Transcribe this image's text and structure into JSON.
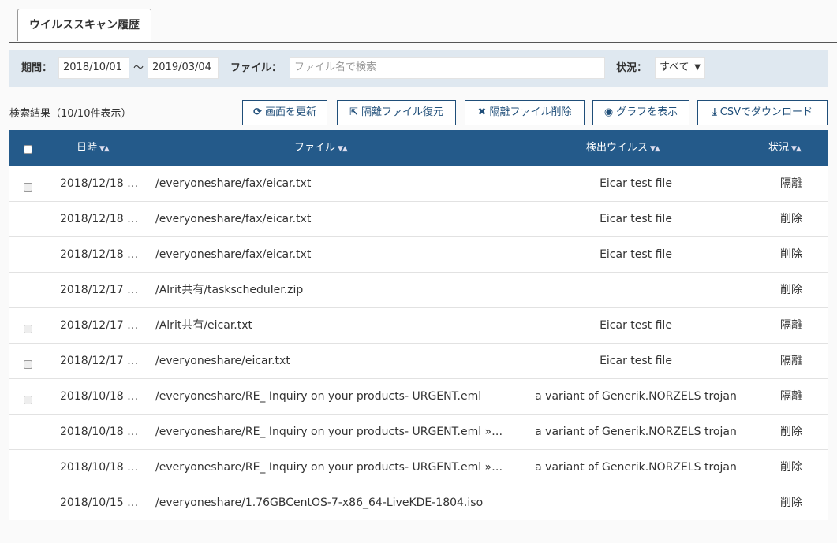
{
  "tab": {
    "label": "ウイルススキャン履歴"
  },
  "filter": {
    "period_label": "期間：",
    "date_from": "2018/10/01",
    "separator": "〜",
    "date_to": "2019/03/04",
    "file_label": "ファイル：",
    "file_placeholder": "ファイル名で検索",
    "status_label": "状況：",
    "status_selected": "すべて"
  },
  "results": {
    "count_text": "検索結果（10/10件表示）"
  },
  "toolbar": {
    "refresh": "画面を更新",
    "restore": "隔離ファイル復元",
    "delete": "隔離ファイル削除",
    "graph": "グラフを表示",
    "download": "CSVでダウンロード"
  },
  "table": {
    "headers": {
      "date": "日時",
      "file": "ファイル",
      "virus": "検出ウイルス",
      "status": "状況"
    },
    "rows": [
      {
        "checkbox": true,
        "date": "2018/12/18 …",
        "file": "/everyoneshare/fax/eicar.txt",
        "virus": "Eicar test file",
        "status": "隔離"
      },
      {
        "checkbox": false,
        "date": "2018/12/18 …",
        "file": "/everyoneshare/fax/eicar.txt",
        "virus": "Eicar test file",
        "status": "削除"
      },
      {
        "checkbox": false,
        "date": "2018/12/18 …",
        "file": "/everyoneshare/fax/eicar.txt",
        "virus": "Eicar test file",
        "status": "削除"
      },
      {
        "checkbox": false,
        "date": "2018/12/17 …",
        "file": "/Alrit共有/taskscheduler.zip",
        "virus": "",
        "status": "削除"
      },
      {
        "checkbox": true,
        "date": "2018/12/17 …",
        "file": "/Alrit共有/eicar.txt",
        "virus": "Eicar test file",
        "status": "隔離"
      },
      {
        "checkbox": true,
        "date": "2018/12/17 …",
        "file": "/everyoneshare/eicar.txt",
        "virus": "Eicar test file",
        "status": "隔離"
      },
      {
        "checkbox": true,
        "date": "2018/10/18 …",
        "file": "/everyoneshare/RE_ Inquiry on your products- URGENT.eml",
        "virus": "a variant of Generik.NORZELS trojan",
        "status": "隔離"
      },
      {
        "checkbox": false,
        "date": "2018/10/18 …",
        "file": "/everyoneshare/RE_ Inquiry on your products- URGENT.eml »…",
        "virus": "a variant of Generik.NORZELS trojan",
        "status": "削除"
      },
      {
        "checkbox": false,
        "date": "2018/10/18 …",
        "file": "/everyoneshare/RE_ Inquiry on your products- URGENT.eml »…",
        "virus": "a variant of Generik.NORZELS trojan",
        "status": "削除"
      },
      {
        "checkbox": false,
        "date": "2018/10/15 …",
        "file": "/everyoneshare/1.76GBCentOS-7-x86_64-LiveKDE-1804.iso",
        "virus": "",
        "status": "削除"
      }
    ]
  }
}
